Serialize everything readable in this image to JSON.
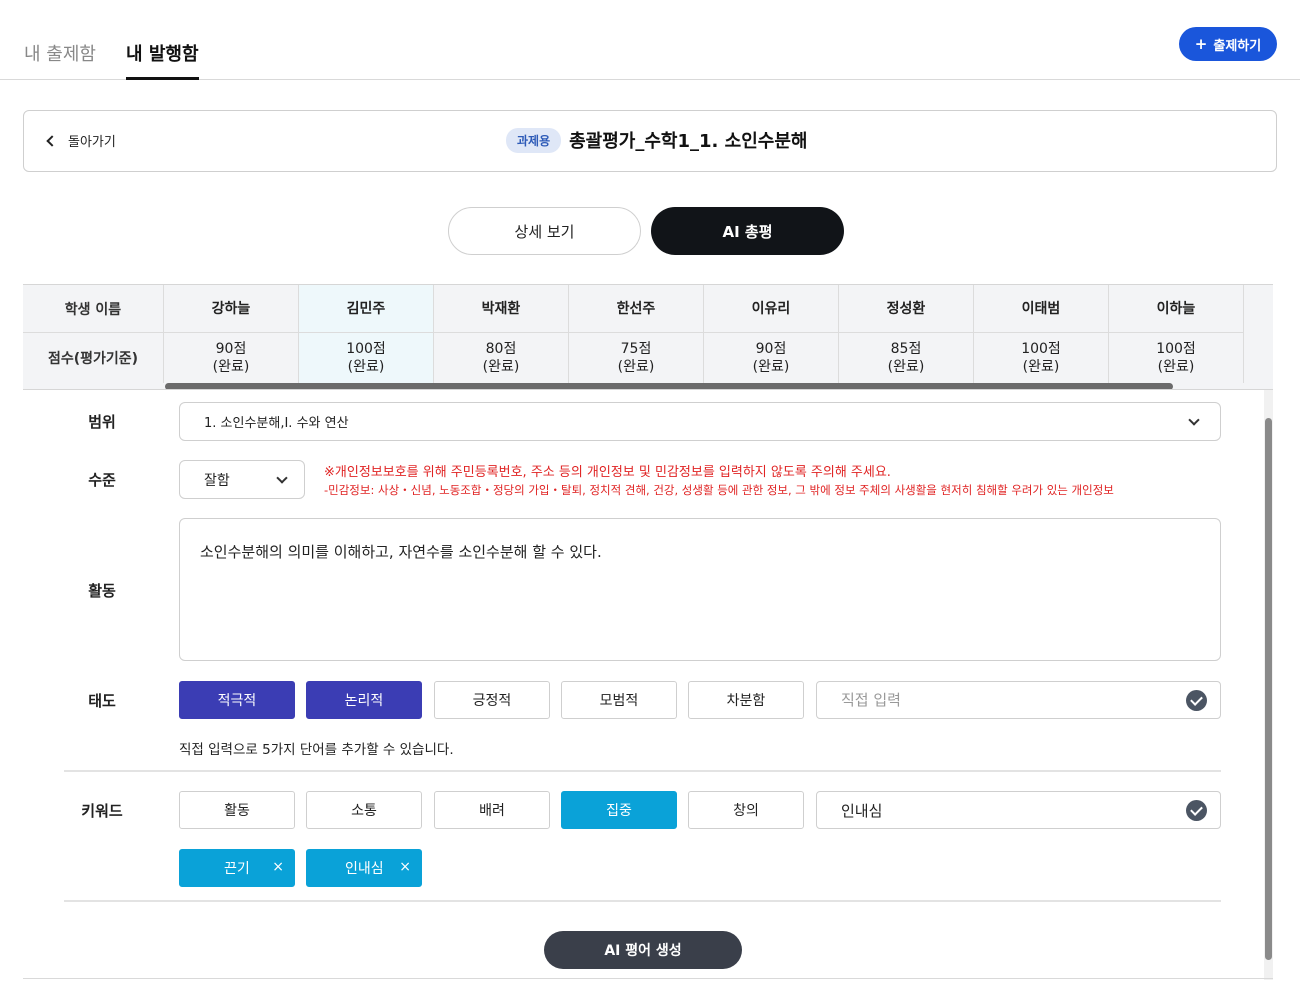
{
  "top_tabs": {
    "my_questions": "내 출제함",
    "my_published": "내 발행함"
  },
  "publish_button": {
    "icon": "+",
    "label": "출제하기"
  },
  "header": {
    "back_label": "돌아가기",
    "badge": "과제용",
    "title": "총괄평가_수학1_1. 소인수분해"
  },
  "segments": {
    "detail": "상세 보기",
    "ai_review": "AI 총평"
  },
  "student_table": {
    "name_header": "학생 이름",
    "score_header": "점수(평가기준)",
    "students": [
      {
        "name": "강하늘",
        "score": "90점",
        "status": "(완료)"
      },
      {
        "name": "김민주",
        "score": "100점",
        "status": "(완료)"
      },
      {
        "name": "박재환",
        "score": "80점",
        "status": "(완료)"
      },
      {
        "name": "한선주",
        "score": "75점",
        "status": "(완료)"
      },
      {
        "name": "이유리",
        "score": "90점",
        "status": "(완료)"
      },
      {
        "name": "정성환",
        "score": "85점",
        "status": "(완료)"
      },
      {
        "name": "이태범",
        "score": "100점",
        "status": "(완료)"
      },
      {
        "name": "이하늘",
        "score": "100점",
        "status": "(완료)"
      }
    ],
    "selected_student": "김민주"
  },
  "form": {
    "range_label": "범위",
    "range_value": "1. 소인수분해,I. 수와 연산",
    "level_label": "수준",
    "level_value": "잘함",
    "warning_main": "※개인정보보호를 위해 주민등록번호, 주소 등의 개인정보 및 민감정보를 입력하지 않도록 주의해 주세요.",
    "warning_sub": "-민감정보: 사상・신념, 노동조합・정당의 가입・탈퇴, 정치적 견해, 건강, 성생활 등에 관한 정보, 그 밖에 정보 주체의 사생활을 현저히 침해할 우려가 있는 개인정보",
    "activity_label": "활동",
    "activity_text": "소인수분해의 의미를 이해하고, 자연수를 소인수분해 할 수 있다.",
    "attitude_label": "태도",
    "attitude_chips": [
      "적극적",
      "논리적",
      "긍정적",
      "모범적",
      "차분함"
    ],
    "attitude_selected": [
      "적극적",
      "논리적"
    ],
    "attitude_input_placeholder": "직접 입력",
    "attitude_hint": "직접 입력으로 5가지 단어를 추가할 수 있습니다.",
    "keyword_label": "키워드",
    "keyword_chips": [
      "활동",
      "소통",
      "배려",
      "집중",
      "창의"
    ],
    "keyword_selected": [
      "집중"
    ],
    "keyword_input_value": "인내심",
    "custom_tags": [
      "끈기",
      "인내심"
    ],
    "tag_remove_icon": "×"
  },
  "generate_button": "AI 평어 생성",
  "colors": {
    "primary_blue": "#1a56db",
    "selected_purple": "#3b3db4",
    "selected_cyan": "#0aa2d8",
    "warning_red": "#e02424",
    "dark": "#111418"
  }
}
